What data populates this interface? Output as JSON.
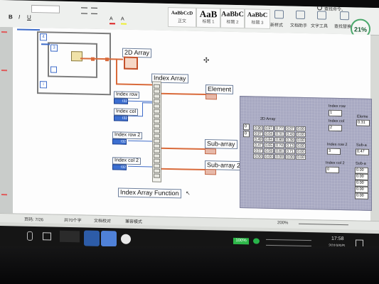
{
  "ribbon": {
    "styles": [
      {
        "big": "AaBbCcD",
        "small": "正文"
      },
      {
        "big": "AaB",
        "small": "标题 1"
      },
      {
        "big": "AaBbC",
        "small": "标题 2"
      },
      {
        "big": "AaBbC",
        "small": "标题 3"
      }
    ],
    "items": [
      "新样式",
      "文档助手",
      "文字工具",
      "查找替换"
    ],
    "search_label": "查找命令、",
    "avatar_text": "21%"
  },
  "diagram": {
    "node_2d_array": "2D Array",
    "index_array_title": "Index Array",
    "index_row": "Index row",
    "index_col": "Index col",
    "index_row_2": "Index row 2",
    "index_col_2": "Index col 2",
    "element": "Element",
    "sub_array": "Sub-array",
    "sub_array_2": "Sub-array 2",
    "function_label": "Index Array Function",
    "numeric_ctl_text": "I32",
    "loop_index_1": "4",
    "loop_index_2": "3",
    "loop_index_3": "i"
  },
  "front_panel": {
    "array_label": "2D Array",
    "index_display_1": "0",
    "index_display_2": "0",
    "values": [
      [
        "0.90",
        "0.97",
        "0.77",
        "0.07",
        "0.00"
      ],
      [
        "0.97",
        "0.04",
        "0.31",
        "0.43",
        "0.00"
      ],
      [
        "0.49",
        "0.84",
        "0.80",
        "0.39",
        "0.00"
      ],
      [
        "0.47",
        "0.65",
        "0.74",
        "0.13",
        "0.00"
      ],
      [
        "0.57",
        "0.59",
        "0.81",
        "0.71",
        "0.00"
      ],
      [
        "0.00",
        "0.00",
        "0.00",
        "0.00",
        "0.00"
      ]
    ],
    "index_row_label": "Index row",
    "index_row_value": "1",
    "index_col_label": "Index col",
    "index_col_value": "2",
    "index_row2_label": "Index row 2",
    "index_row2_value": "3",
    "index_col2_label": "Index col 2",
    "index_col2_value": "0",
    "element_label": "Eleme",
    "element_value": "0.31",
    "subarray_label": "Sub-a",
    "subarray_value": "0.47",
    "subarray2_label": "Sub-a",
    "subarray2_values": [
      "0.00",
      "0.00",
      "0.00",
      "0.00",
      "0.00"
    ]
  },
  "statusbar": {
    "page_info": "页码: 7/26",
    "word_count": "共70个字",
    "proof": "文档校对",
    "mode": "兼容模式",
    "zoom": "200%"
  },
  "taskbar": {
    "battery": "100%",
    "time": "17:58",
    "date": "2019/9/5"
  }
}
